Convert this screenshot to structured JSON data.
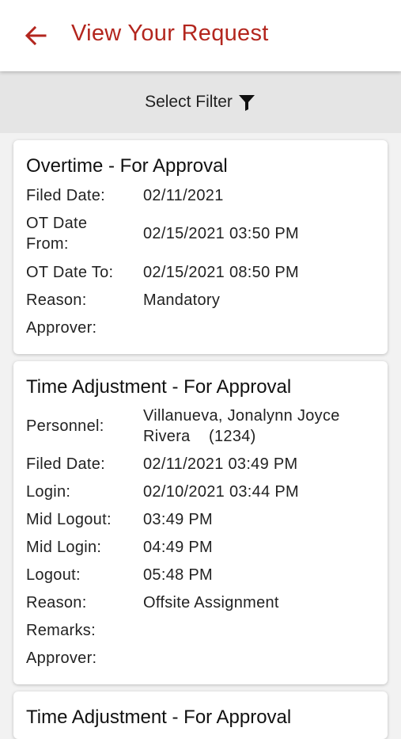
{
  "header": {
    "title": "View Your Request"
  },
  "filter": {
    "label": "Select Filter"
  },
  "cards": [
    {
      "title": "Overtime - For Approval",
      "rows": [
        {
          "label": "Filed Date:",
          "value": "02/11/2021"
        },
        {
          "label": "OT Date From:",
          "value": "02/15/2021 03:50 PM"
        },
        {
          "label": "OT Date To:",
          "value": "02/15/2021 08:50 PM"
        },
        {
          "label": "Reason:",
          "value": "Mandatory"
        },
        {
          "label": "Approver:",
          "value": ""
        }
      ]
    },
    {
      "title": "Time Adjustment - For Approval",
      "rows": [
        {
          "label": "Personnel:",
          "value": "Villanueva, Jonalynn Joyce Rivera    (1234)"
        },
        {
          "label": "Filed Date:",
          "value": "02/11/2021 03:49 PM"
        },
        {
          "label": "Login:",
          "value": "02/10/2021 03:44 PM"
        },
        {
          "label": "Mid Logout:",
          "value": "03:49 PM"
        },
        {
          "label": "Mid Login:",
          "value": "04:49 PM"
        },
        {
          "label": "Logout:",
          "value": "05:48 PM"
        },
        {
          "label": "Reason:",
          "value": "Offsite Assignment"
        },
        {
          "label": "Remarks:",
          "value": ""
        },
        {
          "label": "Approver:",
          "value": ""
        }
      ]
    },
    {
      "title": "Time Adjustment - For Approval",
      "rows": []
    }
  ],
  "colors": {
    "accent": "#b3261e",
    "filter_bar": "#e5e5e5",
    "background": "#f2f2f2"
  },
  "icons": {
    "back": "arrow-left-icon",
    "filter": "funnel-icon"
  }
}
